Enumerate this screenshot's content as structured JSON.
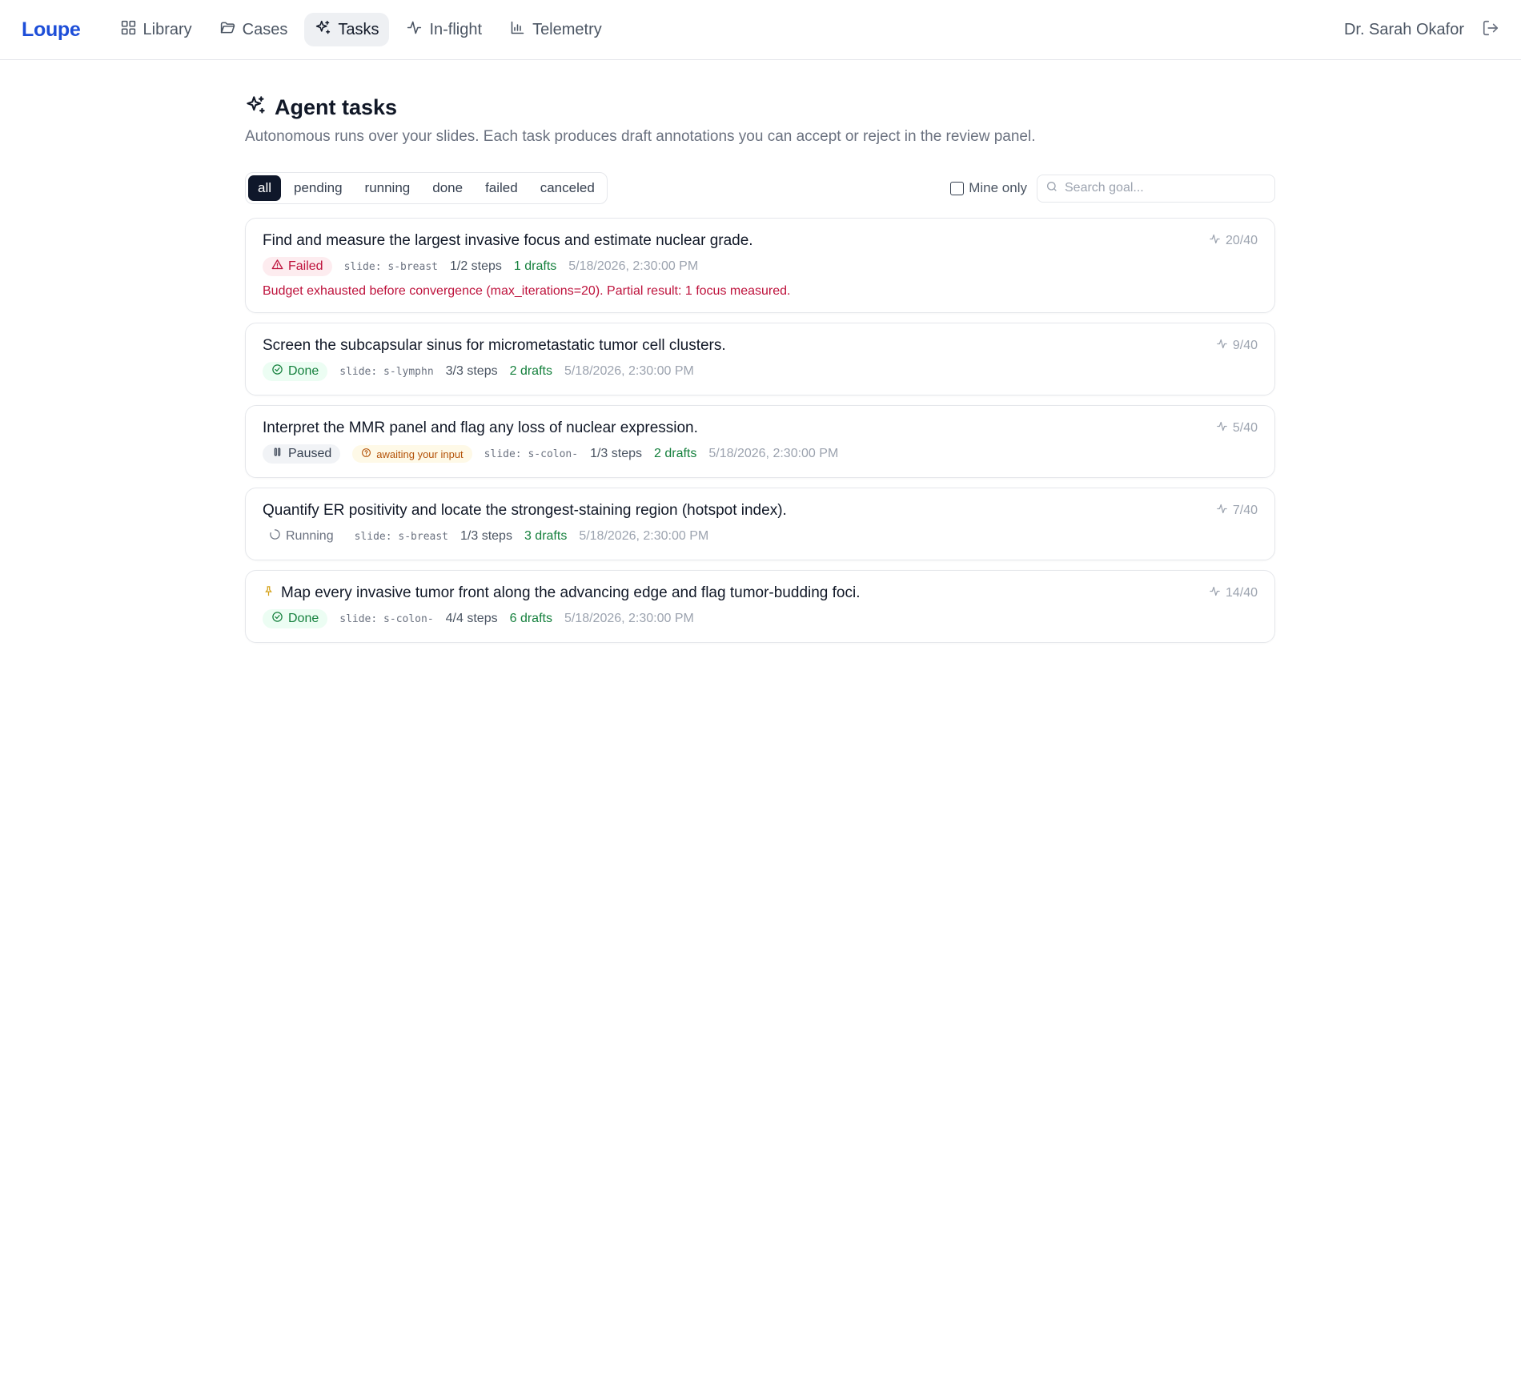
{
  "app": {
    "brand": "Loupe"
  },
  "nav": {
    "items": [
      {
        "label": "Library",
        "icon": "grid-icon"
      },
      {
        "label": "Cases",
        "icon": "folder-icon"
      },
      {
        "label": "Tasks",
        "icon": "sparkles-icon",
        "active": true
      },
      {
        "label": "In-flight",
        "icon": "activity-icon"
      },
      {
        "label": "Telemetry",
        "icon": "bar-chart-icon"
      }
    ],
    "user_name": "Dr. Sarah Okafor"
  },
  "page": {
    "title": "Agent tasks",
    "subtitle": "Autonomous runs over your slides. Each task produces draft annotations you can accept or reject in the review panel."
  },
  "filters": {
    "options": [
      "all",
      "pending",
      "running",
      "done",
      "failed",
      "canceled"
    ],
    "selected": "all",
    "mine_only_label": "Mine only",
    "mine_only_checked": false,
    "search_placeholder": "Search goal..."
  },
  "tasks": [
    {
      "goal": "Find and measure the largest invasive focus and estimate nuclear grade.",
      "status": "Failed",
      "slide": "slide: s-breast",
      "steps": "1/2 steps",
      "drafts": "1 drafts",
      "time": "5/18/2026, 2:30:00 PM",
      "iterations": "20/40",
      "error": "Budget exhausted before convergence (max_iterations=20). Partial result: 1 focus measured."
    },
    {
      "goal": "Screen the subcapsular sinus for micrometastatic tumor cell clusters.",
      "status": "Done",
      "slide": "slide: s-lymphn",
      "steps": "3/3 steps",
      "drafts": "2 drafts",
      "time": "5/18/2026, 2:30:00 PM",
      "iterations": "9/40"
    },
    {
      "goal": "Interpret the MMR panel and flag any loss of nuclear expression.",
      "status": "Paused",
      "awaiting": "awaiting your input",
      "slide": "slide: s-colon-",
      "steps": "1/3 steps",
      "drafts": "2 drafts",
      "time": "5/18/2026, 2:30:00 PM",
      "iterations": "5/40"
    },
    {
      "goal": "Quantify ER positivity and locate the strongest-staining region (hotspot index).",
      "status": "Running",
      "slide": "slide: s-breast",
      "steps": "1/3 steps",
      "drafts": "3 drafts",
      "time": "5/18/2026, 2:30:00 PM",
      "iterations": "7/40"
    },
    {
      "goal": "Map every invasive tumor front along the advancing edge and flag tumor-budding foci.",
      "status": "Done",
      "pinned": true,
      "slide": "slide: s-colon-",
      "steps": "4/4 steps",
      "drafts": "6 drafts",
      "time": "5/18/2026, 2:30:00 PM",
      "iterations": "14/40"
    }
  ],
  "colors": {
    "brand": "#1d4ed8",
    "failed": "#be123c",
    "done": "#15803d",
    "awaiting": "#b45309",
    "pin": "#d4a017"
  }
}
